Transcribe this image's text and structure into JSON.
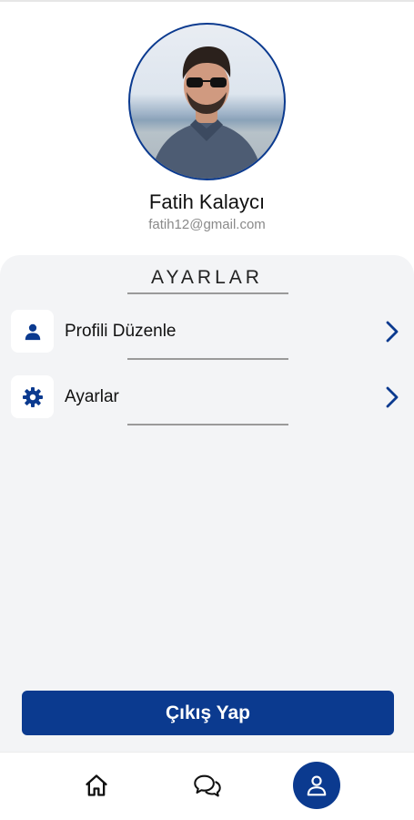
{
  "profile": {
    "name": "Fatih Kalaycı",
    "email": "fatih12@gmail.com"
  },
  "settings": {
    "title": "AYARLAR",
    "items": [
      {
        "label": "Profili Düzenle",
        "icon": "person-icon"
      },
      {
        "label": "Ayarlar",
        "icon": "gear-icon"
      }
    ]
  },
  "logout_label": "Çıkış Yap",
  "bottom_nav": {
    "items": [
      {
        "icon": "home-icon",
        "active": false
      },
      {
        "icon": "chat-icon",
        "active": false
      },
      {
        "icon": "person-icon",
        "active": true
      }
    ]
  },
  "colors": {
    "accent": "#0b3a8f",
    "panel_background": "#f3f4f6",
    "email_text": "#8a8a8a"
  }
}
